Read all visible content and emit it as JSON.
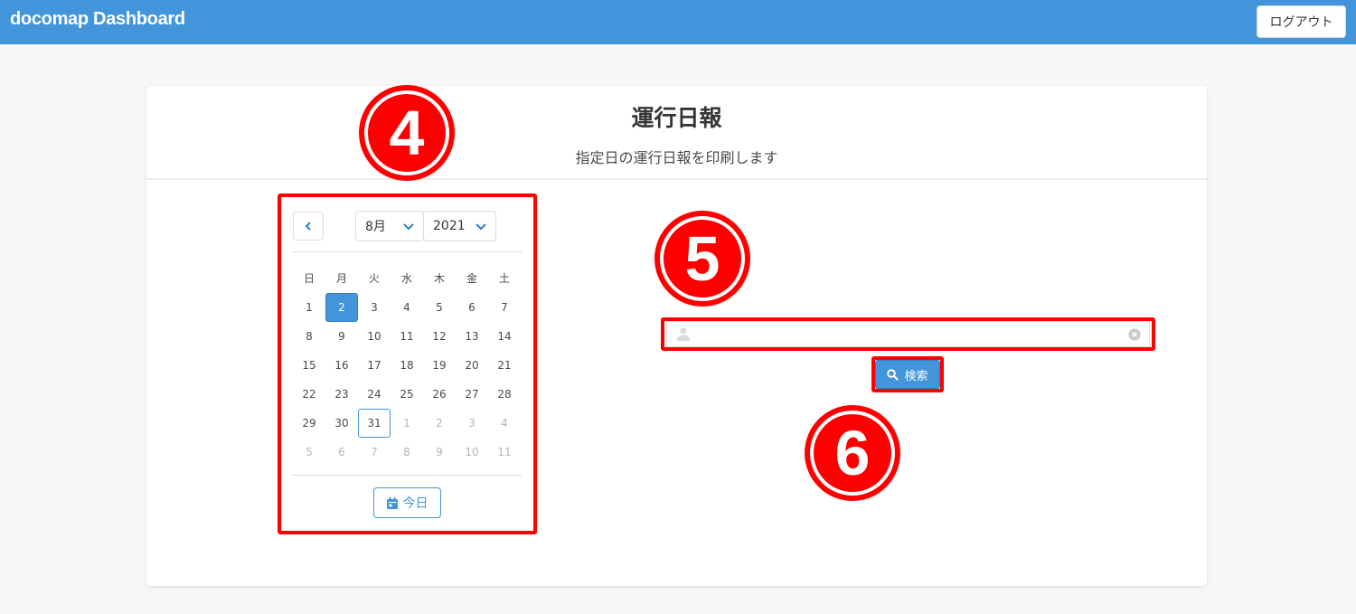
{
  "navbar": {
    "brand": "docomap Dashboard",
    "logout_label": "ログアウト"
  },
  "card": {
    "title": "運行日報",
    "subtitle": "指定日の運行日報を印刷します"
  },
  "annotations": {
    "calendar_marker": "4",
    "search_input_marker": "5",
    "search_button_marker": "6",
    "highlight_color": "#ff0000"
  },
  "calendar": {
    "month": "8月",
    "year": "2021",
    "weekdays": [
      "日",
      "月",
      "火",
      "水",
      "木",
      "金",
      "土"
    ],
    "weeks": [
      [
        "1",
        "2",
        "3",
        "4",
        "5",
        "6",
        "7"
      ],
      [
        "8",
        "9",
        "10",
        "11",
        "12",
        "13",
        "14"
      ],
      [
        "15",
        "16",
        "17",
        "18",
        "19",
        "20",
        "21"
      ],
      [
        "22",
        "23",
        "24",
        "25",
        "26",
        "27",
        "28"
      ],
      [
        "29",
        "30",
        "31",
        "1",
        "2",
        "3",
        "4"
      ],
      [
        "5",
        "6",
        "7",
        "8",
        "9",
        "10",
        "11"
      ]
    ],
    "selected_day": "2",
    "today_day": "31",
    "today_label": "今日"
  },
  "search": {
    "input_value": "",
    "button_label": "検索"
  },
  "colors": {
    "accent": "#4294db",
    "background": "#f7f7f7"
  },
  "icons": {
    "prev": "chevron-left-icon",
    "dropdown": "chevron-down-icon",
    "today": "calendar-icon",
    "user": "user-icon",
    "clear": "clear-circle-icon",
    "search": "search-icon"
  }
}
